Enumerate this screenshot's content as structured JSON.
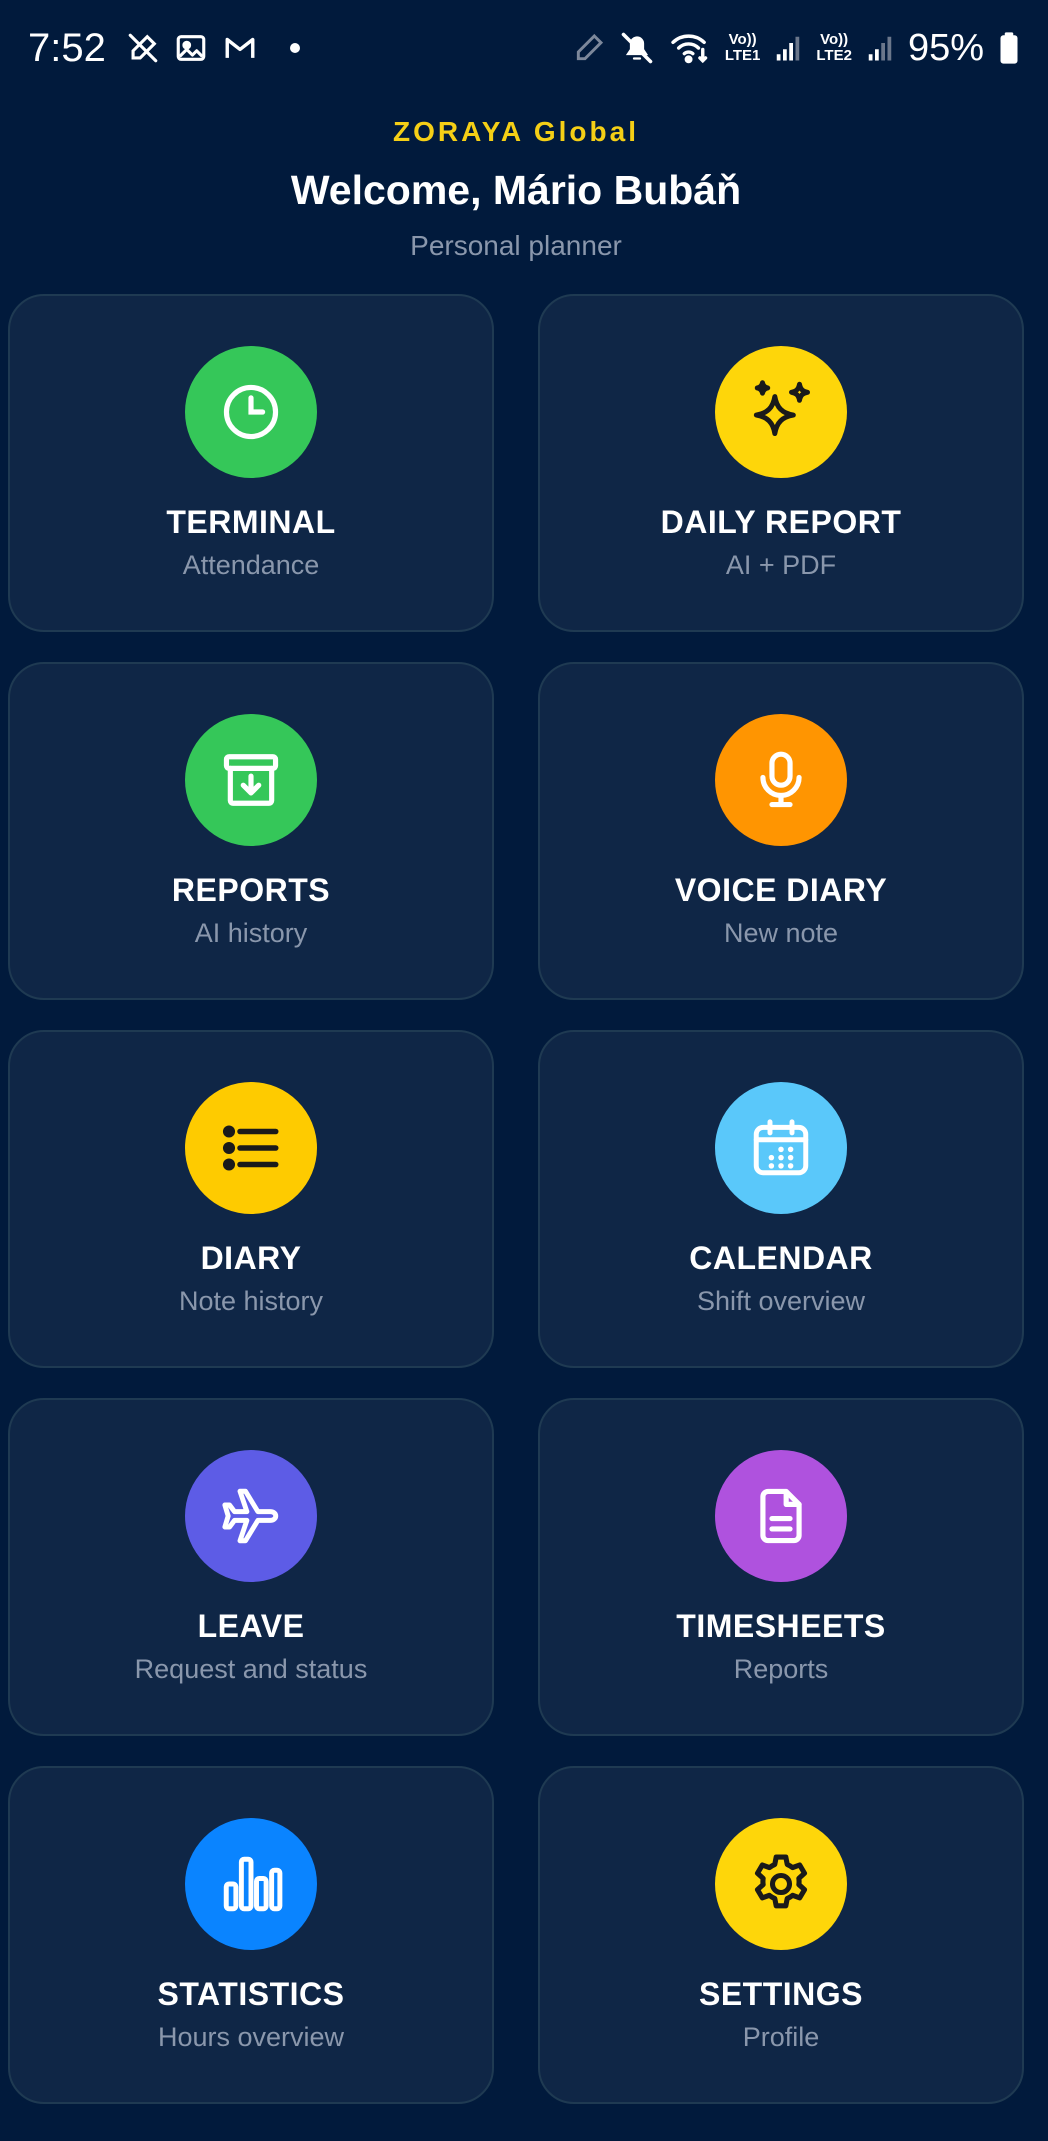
{
  "status_bar": {
    "time": "7:52",
    "lte1_top": "Vo))",
    "lte1_bottom": "LTE1",
    "lte2_top": "Vo))",
    "lte2_bottom": "LTE2",
    "battery": "95%",
    "icons": [
      "pen-off-icon",
      "image-icon",
      "gmail-icon",
      "pencil-icon",
      "mute-icon",
      "wifi-icon",
      "signal-icon",
      "battery-icon"
    ]
  },
  "header": {
    "brand": "ZORAYA Global",
    "welcome": "Welcome, Mário Bubáň",
    "subtitle": "Personal planner"
  },
  "tiles": [
    {
      "title": "TERMINAL",
      "subtitle": "Attendance",
      "icon": "clock-icon",
      "color": "#35c759"
    },
    {
      "title": "DAILY REPORT",
      "subtitle": "AI + PDF",
      "icon": "sparkles-icon",
      "color": "#fed60a"
    },
    {
      "title": "REPORTS",
      "subtitle": "AI history",
      "icon": "archive-icon",
      "color": "#35c759"
    },
    {
      "title": "VOICE DIARY",
      "subtitle": "New note",
      "icon": "microphone-icon",
      "color": "#ff9501"
    },
    {
      "title": "DIARY",
      "subtitle": "Note history",
      "icon": "list-icon",
      "color": "#fecb00"
    },
    {
      "title": "CALENDAR",
      "subtitle": "Shift overview",
      "icon": "calendar-icon",
      "color": "#5ac8fa"
    },
    {
      "title": "LEAVE",
      "subtitle": "Request and status",
      "icon": "airplane-icon",
      "color": "#5d5ce6"
    },
    {
      "title": "TIMESHEETS",
      "subtitle": "Reports",
      "icon": "document-icon",
      "color": "#af52de"
    },
    {
      "title": "STATISTICS",
      "subtitle": "Hours overview",
      "icon": "bar-chart-icon",
      "color": "#0a84ff"
    },
    {
      "title": "SETTINGS",
      "subtitle": "Profile",
      "icon": "gear-icon",
      "color": "#fed60a"
    }
  ]
}
